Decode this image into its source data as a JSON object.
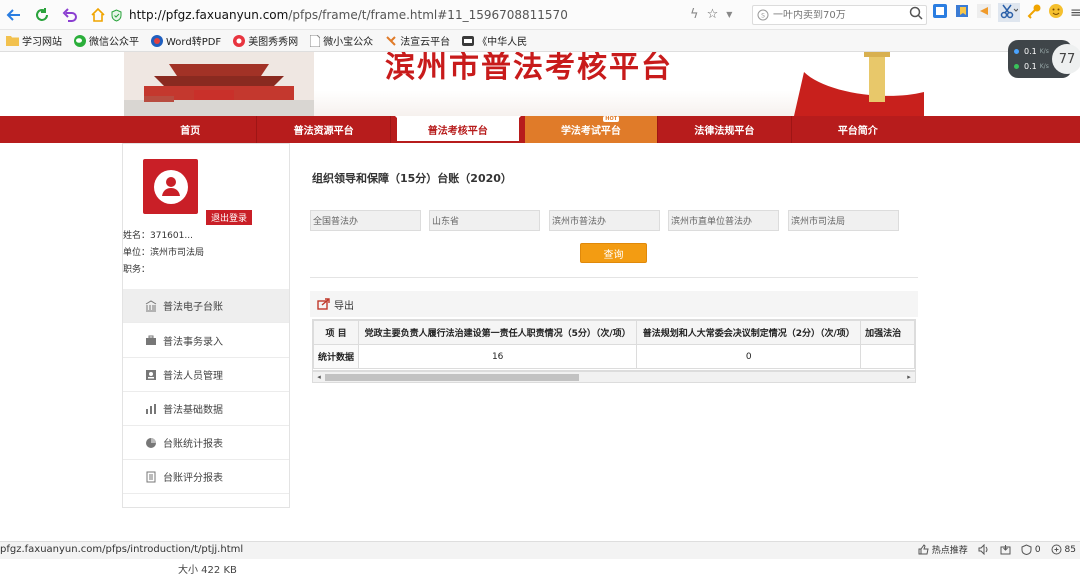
{
  "browser": {
    "url_host": "http://pfgz.faxuanyun.com",
    "url_path": "/pfps/frame/t/frame.html#11_1596708811570",
    "search_placeholder": "一叶内卖到70万",
    "bookmarks": [
      {
        "label": "学习网站",
        "icon": "folder-icon"
      },
      {
        "label": "微信公众平",
        "icon": "wechat-icon"
      },
      {
        "label": "Word转PDF",
        "icon": "word-pdf-icon"
      },
      {
        "label": "美图秀秀网",
        "icon": "meitu-icon"
      },
      {
        "label": "微小宝公众",
        "icon": "page-icon"
      },
      {
        "label": "法宣云平台",
        "icon": "faxuan-icon"
      },
      {
        "label": "《中华人民",
        "icon": "baike-icon"
      }
    ],
    "net_up": "0.1",
    "net_down": "0.1",
    "net_unit": "K/s",
    "net_ring": "77",
    "status_url": "pfgz.faxuanyun.com/pfps/introduction/t/ptjj.html",
    "status_right": {
      "hot": "热点推荐",
      "count": "0",
      "zoom": "85"
    },
    "file_size": "大小 422 KB",
    "colors": {
      "nav_red": "#b71c1c",
      "accent_orange": "#f39c12"
    }
  },
  "site": {
    "title": "滨州市普法考核平台",
    "nav": [
      {
        "label": "首页"
      },
      {
        "label": "普法资源平台"
      },
      {
        "label": "普法考核平台"
      },
      {
        "label": "学法考试平台",
        "badge": "HOT"
      },
      {
        "label": "法律法规平台"
      },
      {
        "label": "平台简介"
      }
    ]
  },
  "sidebar": {
    "logout": "退出登录",
    "name": "姓名：371601...",
    "unit": "单位：滨州市司法局",
    "position": "职务：",
    "menu": [
      {
        "label": "普法电子台账",
        "icon": "ledger-icon"
      },
      {
        "label": "普法事务录入",
        "icon": "briefcase-icon"
      },
      {
        "label": "普法人员管理",
        "icon": "person-card-icon"
      },
      {
        "label": "普法基础数据",
        "icon": "bar-chart-icon"
      },
      {
        "label": "台账统计报表",
        "icon": "pie-chart-icon"
      },
      {
        "label": "台账评分报表",
        "icon": "document-icon"
      }
    ]
  },
  "main": {
    "title": "组织领导和保障（15分）台账（2020）",
    "filters": [
      "全国普法办",
      "山东省",
      "滨州市普法办",
      "滨州市直单位普法办",
      "滨州市司法局"
    ],
    "query": "查询",
    "export": "导出",
    "table": {
      "headers": [
        "项 目",
        "党政主要负责人履行法治建设第一责任人职责情况（5分）（次/项）",
        "普法规划和人大常委会决议制定情况（2分）（次/项）",
        "加强法治"
      ],
      "rows": [
        [
          "统计数据",
          "16",
          "0",
          ""
        ]
      ]
    }
  }
}
